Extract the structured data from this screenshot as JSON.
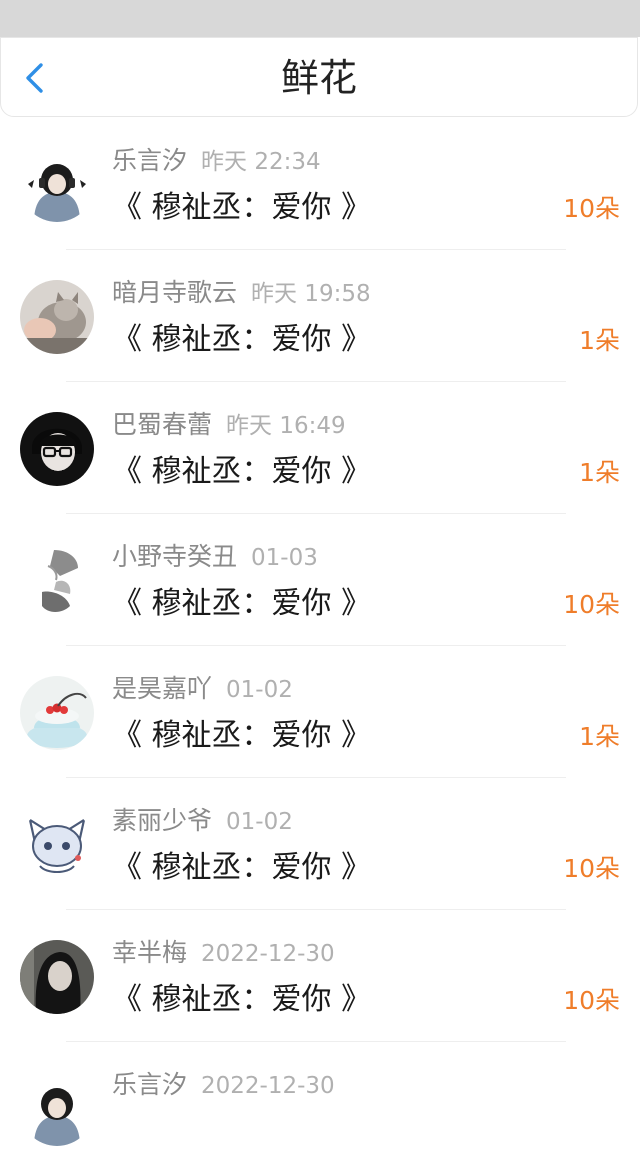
{
  "header": {
    "title": "鲜花",
    "back_icon": "chevron-left-icon",
    "accent_color": "#2f8fe6"
  },
  "gifts": [
    {
      "name": "乐言汐",
      "time": "昨天 22:34",
      "gift": "《 穆祉丞：爱你 》",
      "count": "10朵",
      "avatar": "avatar-hooded-boy"
    },
    {
      "name": "暗月寺歌云",
      "time": "昨天 19:58",
      "gift": "《 穆祉丞：爱你 》",
      "count": "1朵",
      "avatar": "avatar-kitten"
    },
    {
      "name": "巴蜀春蕾",
      "time": "昨天 16:49",
      "gift": "《 穆祉丞：爱你 》",
      "count": "1朵",
      "avatar": "avatar-glasses-boy"
    },
    {
      "name": "小野寺癸丑",
      "time": "01-03",
      "gift": "《 穆祉丞：爱你 》",
      "count": "10朵",
      "avatar": "avatar-grey-sketch"
    },
    {
      "name": "是昊嘉吖",
      "time": "01-02",
      "gift": "《 穆祉丞：爱你 》",
      "count": "1朵",
      "avatar": "avatar-cake"
    },
    {
      "name": "素丽少爷",
      "time": "01-02",
      "gift": "《 穆祉丞：爱你 》",
      "count": "10朵",
      "avatar": "avatar-blue-cat"
    },
    {
      "name": "幸半梅",
      "time": "2022-12-30",
      "gift": "《 穆祉丞：爱你 》",
      "count": "10朵",
      "avatar": "avatar-dark-hair-girl"
    },
    {
      "name": "乐言汐",
      "time": "2022-12-30",
      "gift": "",
      "count": "",
      "avatar": "avatar-hooded-boy"
    }
  ],
  "colors": {
    "count": "#ef7d2a",
    "name": "#8a8a8a",
    "time": "#b0b0b0"
  }
}
